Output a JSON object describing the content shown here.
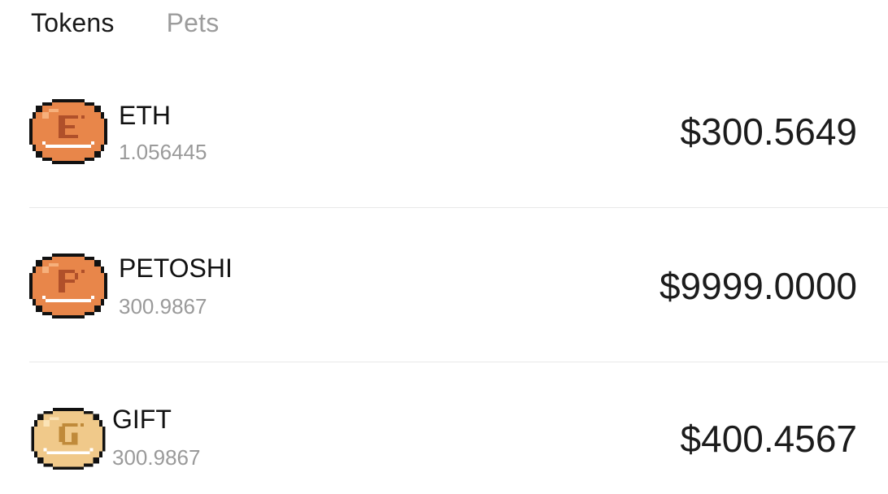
{
  "tabs": [
    {
      "label": "Tokens",
      "active": true
    },
    {
      "label": "Pets",
      "active": false
    }
  ],
  "tokens": [
    {
      "symbol": "ETH",
      "amount": "1.056445",
      "value": "$300.5649",
      "icon": "eth-coin-icon",
      "coin_color": "#e8864a",
      "coin_letter": "E"
    },
    {
      "symbol": "PETOSHI",
      "amount": "300.9867",
      "value": "$9999.0000",
      "icon": "petoshi-coin-icon",
      "coin_color": "#e8864a",
      "coin_letter": "P"
    },
    {
      "symbol": "GIFT",
      "amount": "300.9867",
      "value": "$400.4567",
      "icon": "gift-coin-icon",
      "coin_color": "#f0c98a",
      "coin_letter": "G"
    }
  ],
  "colors": {
    "text_primary": "#111111",
    "text_secondary": "#9a9a9a",
    "tab_inactive": "#9c9c9c",
    "divider": "#e8e8e8"
  }
}
